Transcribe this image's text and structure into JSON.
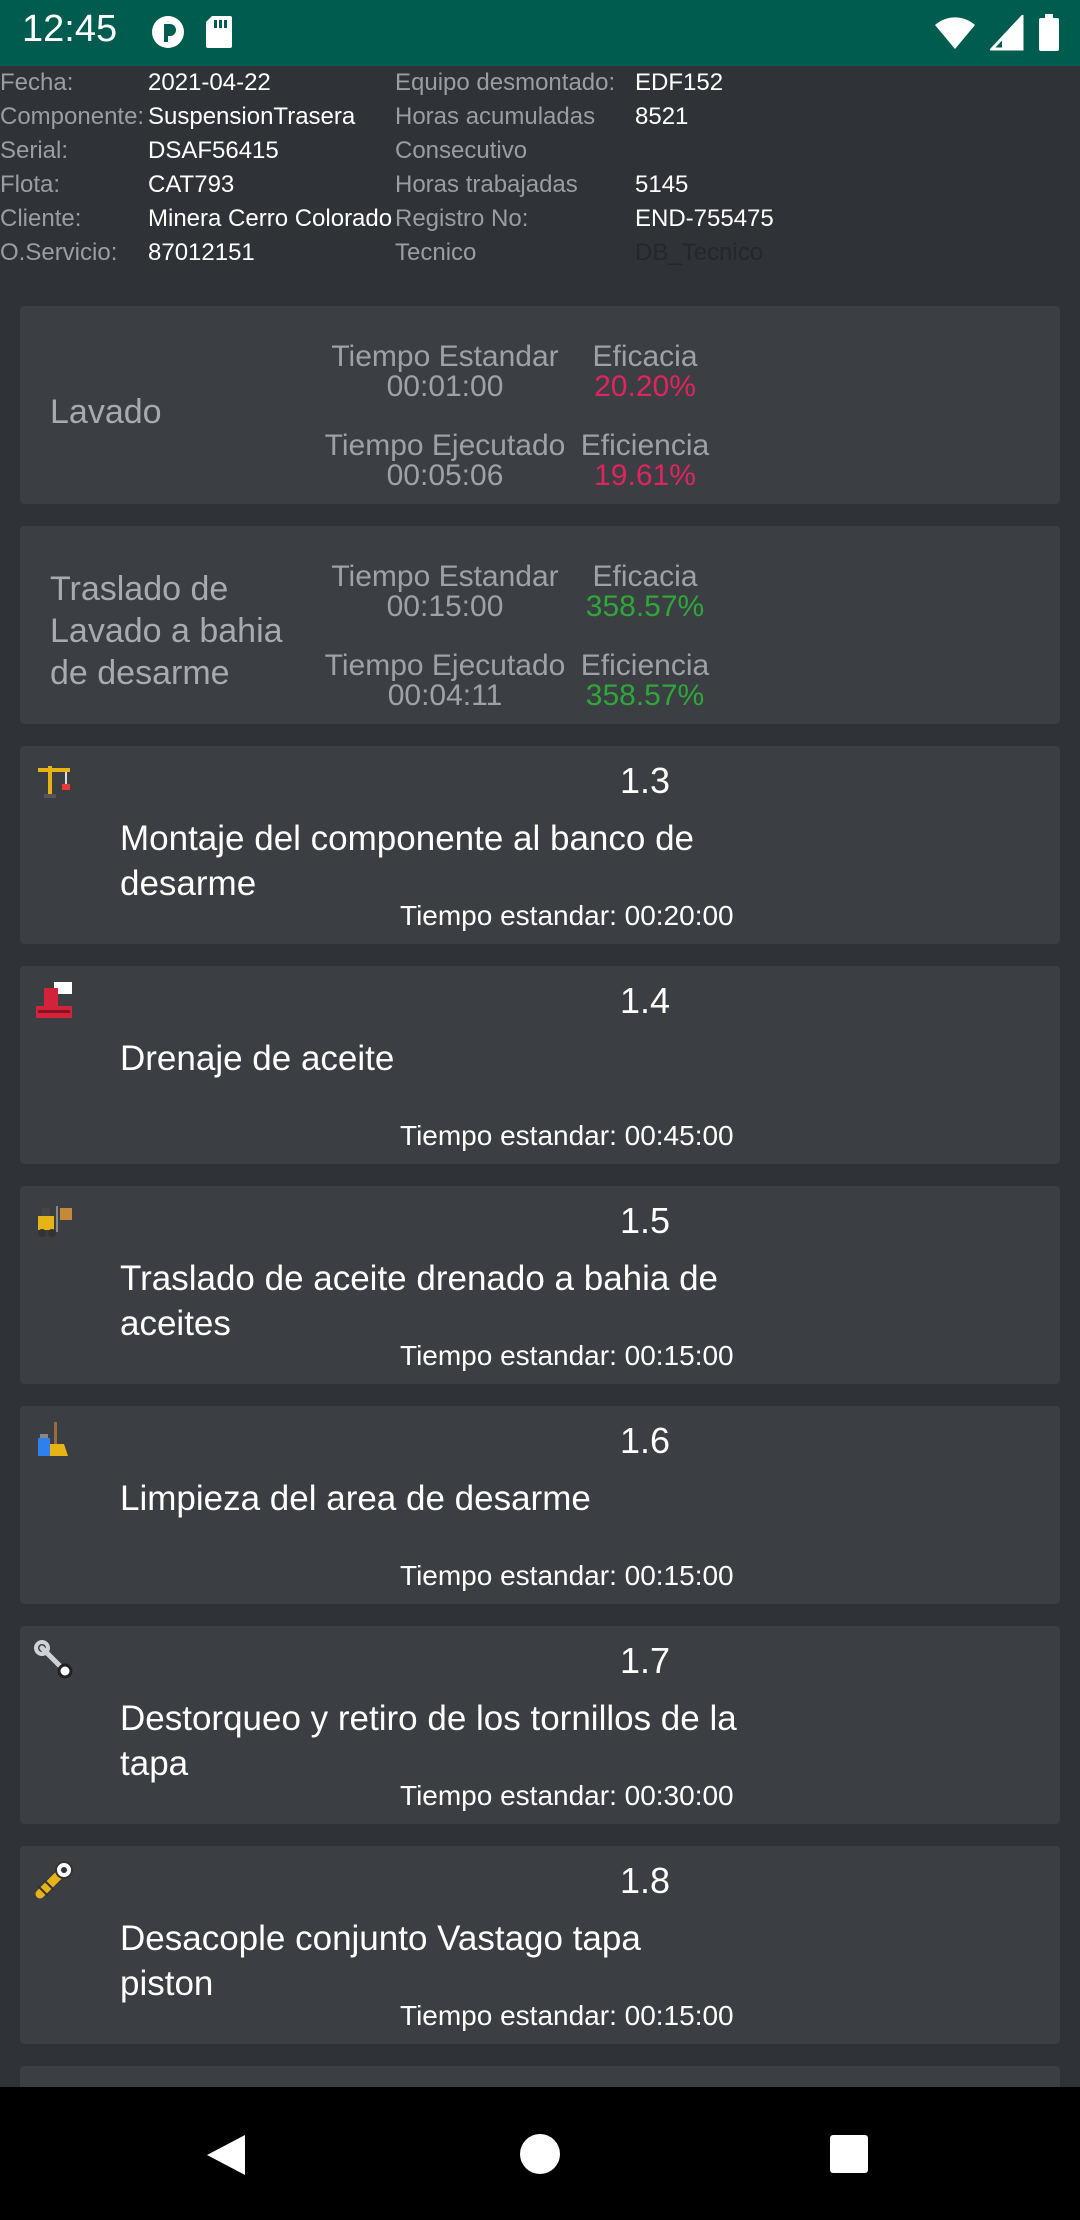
{
  "status_bar": {
    "time": "12:45"
  },
  "header": {
    "left": [
      {
        "label": "Fecha:",
        "value": "2021-04-22"
      },
      {
        "label": "Componente:",
        "value": "SuspensionTrasera"
      },
      {
        "label": "Serial:",
        "value": "DSAF56415"
      },
      {
        "label": "Flota:",
        "value": "CAT793"
      },
      {
        "label": "Cliente:",
        "value": "Minera Cerro Colorado"
      },
      {
        "label": "O.Servicio:",
        "value": "87012151"
      }
    ],
    "right": [
      {
        "label": "Equipo desmontado:",
        "value": "EDF152"
      },
      {
        "label": "Horas acumuladas",
        "value": "8521"
      },
      {
        "label": "Consecutivo",
        "value": ""
      },
      {
        "label": "Horas trabajadas",
        "value": "5145"
      },
      {
        "label": "Registro No:",
        "value": "END-755475"
      },
      {
        "label": "Tecnico",
        "value": "DB_Tecnico"
      }
    ]
  },
  "summary_cards": [
    {
      "name": "Lavado",
      "std_label": "Tiempo Estandar",
      "std_value": "00:01:00",
      "eficacia_label": "Eficacia",
      "eficacia_value": "20.20%",
      "exec_label": "Tiempo Ejecutado",
      "exec_value": "00:05:06",
      "eficiencia_label": "Eficiencia",
      "eficiencia_value": "19.61%",
      "status_color": "#e0245e"
    },
    {
      "name": "Traslado de Lavado a bahia de desarme",
      "std_label": "Tiempo Estandar",
      "std_value": "00:15:00",
      "eficacia_label": "Eficacia",
      "eficacia_value": "358.57%",
      "exec_label": "Tiempo Ejecutado",
      "exec_value": "00:04:11",
      "eficiencia_label": "Eficiencia",
      "eficiencia_value": "358.57%",
      "status_color": "#2fa63a"
    }
  ],
  "tasks": [
    {
      "number": "1.3",
      "title": "Montaje del componente al banco de desarme",
      "standard": "Tiempo estandar: 00:20:00",
      "icon": "crane-icon"
    },
    {
      "number": "1.4",
      "title": "Drenaje de aceite",
      "standard": "Tiempo estandar: 00:45:00",
      "icon": "oil-drain-icon"
    },
    {
      "number": "1.5",
      "title": "Traslado de aceite drenado a bahia de aceites",
      "standard": "Tiempo estandar: 00:15:00",
      "icon": "forklift-icon"
    },
    {
      "number": "1.6",
      "title": "Limpieza del area de desarme",
      "standard": "Tiempo estandar: 00:15:00",
      "icon": "cleaning-icon"
    },
    {
      "number": "1.7",
      "title": "Destorqueo y retiro de los tornillos de la tapa",
      "standard": "Tiempo estandar: 00:30:00",
      "icon": "wrench-icon"
    },
    {
      "number": "1.8",
      "title": "Desacople conjunto Vastago tapa piston",
      "standard": "Tiempo estandar: 00:15:00",
      "icon": "screw-icon"
    }
  ],
  "colors": {
    "status_bar": "#005c4e",
    "background": "#2f3236",
    "card": "#3b3e42",
    "bad": "#e0245e",
    "good": "#2fa63a"
  }
}
